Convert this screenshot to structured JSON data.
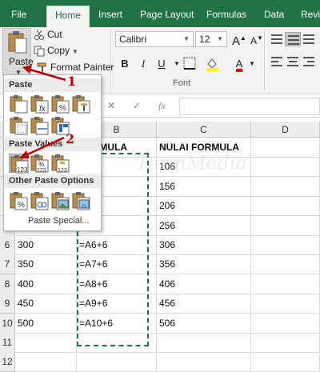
{
  "tabs": [
    "File",
    "Home",
    "Insert",
    "Page Layout",
    "Formulas",
    "Data",
    "Revi"
  ],
  "clipboard": {
    "paste_label": "Paste",
    "cut_label": "Cut",
    "copy_label": "Copy",
    "format_painter_label": "Format Painter"
  },
  "font": {
    "name": "Calibri",
    "size": "12",
    "group_label": "Font"
  },
  "formula_bar": {
    "fx": "fx"
  },
  "paste_menu": {
    "section_paste": "Paste",
    "section_values": "Paste Values",
    "section_other": "Other Paste Options",
    "paste_special": "Paste Special..."
  },
  "columns": [
    "B",
    "C",
    "D"
  ],
  "rows": [
    {
      "num": "",
      "a": "",
      "b": "FORMULA",
      "c": "NULAI FORMULA"
    },
    {
      "num": "",
      "a": "",
      "b": "+6",
      "c": "106"
    },
    {
      "num": "",
      "a": "",
      "b": "+6",
      "c": "156"
    },
    {
      "num": "",
      "a": "",
      "b": "+6",
      "c": "206"
    },
    {
      "num": "",
      "a": "",
      "b": "+6",
      "c": "256"
    },
    {
      "num": "6",
      "a": "300",
      "b": "=A6+6",
      "c": "306"
    },
    {
      "num": "7",
      "a": "350",
      "b": "=A7+6",
      "c": "356"
    },
    {
      "num": "8",
      "a": "400",
      "b": "=A8+6",
      "c": "406"
    },
    {
      "num": "9",
      "a": "450",
      "b": "=A9+6",
      "c": "456"
    },
    {
      "num": "10",
      "a": "500",
      "b": "=A10+6",
      "c": "506"
    },
    {
      "num": "11",
      "a": "",
      "b": "",
      "c": ""
    },
    {
      "num": "12",
      "a": "",
      "b": "",
      "c": ""
    }
  ],
  "annotations": {
    "step1": "1",
    "step2": "2"
  },
  "watermark": "TermMedia",
  "colors": {
    "accent": "#217346",
    "callout": "#c00000"
  }
}
